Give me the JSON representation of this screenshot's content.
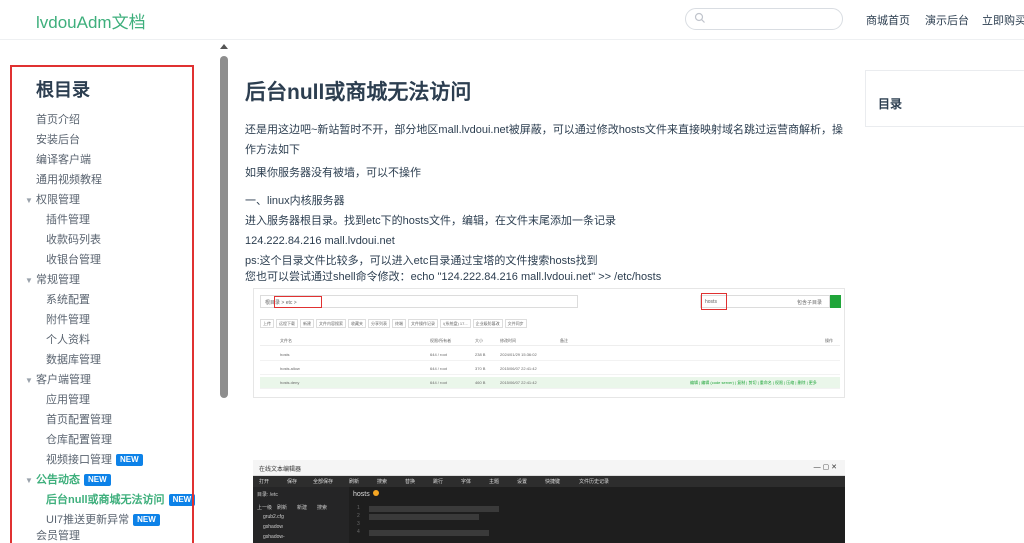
{
  "topbar": {
    "brand": "lvdouAdm文档",
    "search_placeholder": "",
    "nav": [
      "商城首页",
      "演示后台",
      "立即购买"
    ]
  },
  "sidebar": {
    "title": "根目录",
    "items": [
      {
        "label": "首页介绍",
        "level": 0
      },
      {
        "label": "安装后台",
        "level": 0
      },
      {
        "label": "编译客户端",
        "level": 0
      },
      {
        "label": "通用视频教程",
        "level": 0
      },
      {
        "label": "权限管理",
        "level": "group"
      },
      {
        "label": "插件管理",
        "level": 1
      },
      {
        "label": "收款码列表",
        "level": 1
      },
      {
        "label": "收银台管理",
        "level": 1
      },
      {
        "label": "常规管理",
        "level": "group"
      },
      {
        "label": "系统配置",
        "level": 1
      },
      {
        "label": "附件管理",
        "level": 1
      },
      {
        "label": "个人资料",
        "level": 1
      },
      {
        "label": "数据库管理",
        "level": 1
      },
      {
        "label": "客户端管理",
        "level": "group"
      },
      {
        "label": "应用管理",
        "level": 1
      },
      {
        "label": "首页配置管理",
        "level": 1
      },
      {
        "label": "仓库配置管理",
        "level": 1
      },
      {
        "label": "视频接口管理",
        "level": 1,
        "badge": "NEW"
      },
      {
        "label": "公告动态",
        "level": "group-active",
        "badge": "NEW"
      },
      {
        "label": "后台null或商城无法访问",
        "level": 1,
        "active": true,
        "badge": "NEW"
      },
      {
        "label": "UI7推送更新异常",
        "level": 1,
        "badge": "NEW"
      }
    ],
    "bottom_item": "会员管理"
  },
  "article": {
    "title": "后台null或商城无法访问",
    "paragraphs": [
      "还是用这边吧~新站暂时不开，部分地区mall.lvdoui.net被屏蔽，可以通过修改hosts文件来直接映射域名跳过运营商解析，操作方法如下",
      "如果你服务器没有被墙，可以不操作",
      "一、linux内核服务器",
      "进入服务器根目录。找到etc下的hosts文件，编辑，在文件末尾添加一条记录",
      "124.222.84.216 mall.lvdoui.net",
      "ps:这个目录文件比较多，可以进入etc目录通过宝塔的文件搜索hosts找到",
      "您也可以尝试通过shell命令修改：echo \"124.222.84.216 mall.lvdoui.net\" >> /etc/hosts"
    ]
  },
  "screenshot_filemanager": {
    "path_text": "根目录 > etc >",
    "search_value": "hosts",
    "search_option": "包含子目录",
    "toolbar": [
      "上传",
      "远程下载",
      "新建",
      "文件内容搜索",
      "收藏夹",
      "分享列表",
      "终端",
      "文件操作记录",
      "/(系统盘) 17...",
      "企业级防篡改",
      "文件同步"
    ],
    "columns": [
      "文件名",
      "权限/所有者",
      "大小",
      "修改时间",
      "备注",
      "操作"
    ],
    "rows": [
      {
        "name": "hosts",
        "owner": "644 / root",
        "size": "238 B",
        "mtime": "2024/01/29 15:36:02"
      },
      {
        "name": "hosts.allow",
        "owner": "644 / root",
        "size": "370 B",
        "mtime": "2015/06/07 22:41:42"
      },
      {
        "name": "hosts.deny",
        "owner": "644 / root",
        "size": "460 B",
        "mtime": "2015/06/07 22:41:42",
        "actions": "编辑 | 编辑 (code server) | 复制 | 剪切 | 重命名 | 权限 | 压缩 | 删除 | 更多"
      }
    ]
  },
  "screenshot_editor": {
    "title": "在线文本编辑器",
    "menu": [
      "打开",
      "保存",
      "全部保存",
      "刷新",
      "搜索",
      "替换",
      "跳行",
      "字体",
      "主题",
      "设置",
      "快捷键",
      "文件历史记录"
    ],
    "dir_label": "目录: /etc",
    "tab": "hosts",
    "side_items": [
      "上一级",
      "刷新",
      "新建",
      "搜索",
      "grub2.cfg",
      "gshadow",
      "gshadow-"
    ]
  },
  "toc": {
    "title": "目录"
  }
}
